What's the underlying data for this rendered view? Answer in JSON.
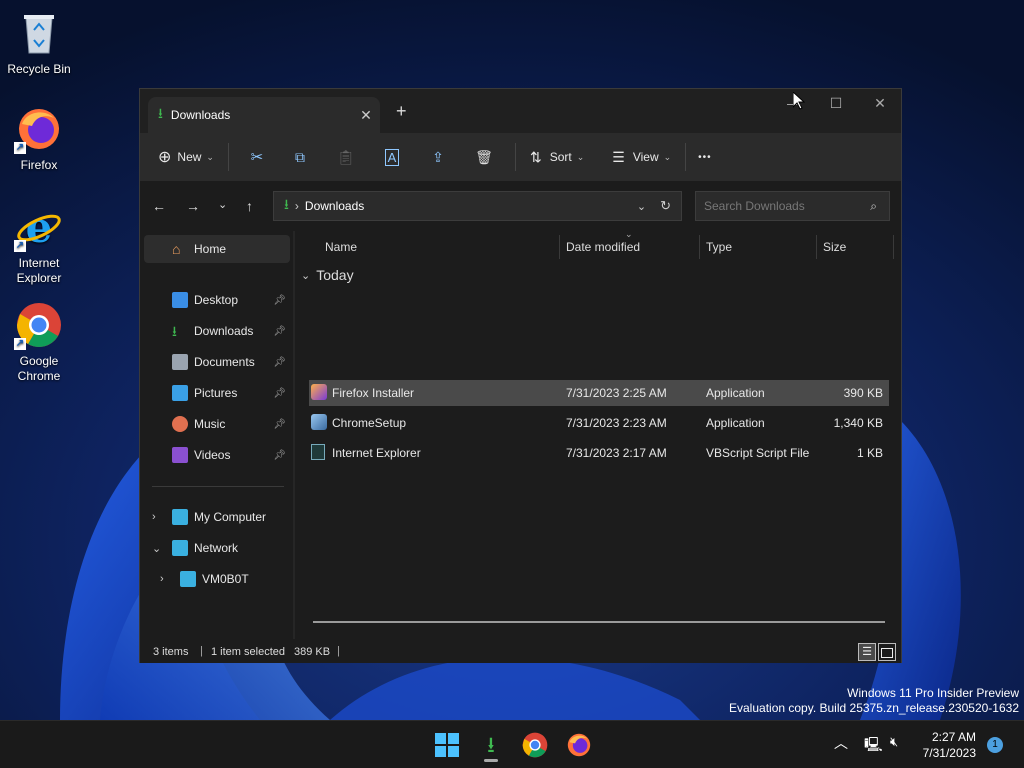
{
  "desktop": {
    "icons": [
      {
        "label": "Recycle Bin"
      },
      {
        "label": "Firefox"
      },
      {
        "label": "Internet Explorer"
      },
      {
        "label": "Google Chrome"
      }
    ],
    "watermark_line1": "Windows 11 Pro Insider Preview",
    "watermark_line2": "Evaluation copy. Build 25375.zn_release.230520-1632"
  },
  "explorer": {
    "tab_title": "Downloads",
    "toolbar": {
      "new_label": "New",
      "sort_label": "Sort",
      "view_label": "View",
      "more_label": "•••"
    },
    "address": {
      "current": "Downloads",
      "search_placeholder": "Search Downloads"
    },
    "nav": {
      "home": "Home",
      "quick_access": [
        {
          "label": "Desktop"
        },
        {
          "label": "Downloads"
        },
        {
          "label": "Documents"
        },
        {
          "label": "Pictures"
        },
        {
          "label": "Music"
        },
        {
          "label": "Videos"
        }
      ],
      "my_computer": "My Computer",
      "network": "Network",
      "network_child": "VM0B0T"
    },
    "columns": {
      "name": "Name",
      "date": "Date modified",
      "type": "Type",
      "size": "Size"
    },
    "group_label": "Today",
    "files": [
      {
        "name": "Firefox Installer",
        "date": "7/31/2023 2:25 AM",
        "type": "Application",
        "size": "390 KB",
        "selected": true
      },
      {
        "name": "ChromeSetup",
        "date": "7/31/2023 2:23 AM",
        "type": "Application",
        "size": "1,340 KB",
        "selected": false
      },
      {
        "name": "Internet Explorer",
        "date": "7/31/2023 2:17 AM",
        "type": "VBScript Script File",
        "size": "1 KB",
        "selected": false
      }
    ],
    "status": {
      "items": "3 items",
      "selected": "1 item selected",
      "size": "389 KB"
    }
  },
  "taskbar": {
    "time": "2:27 AM",
    "date": "7/31/2023",
    "notification_count": "1"
  },
  "colors": {
    "accent": "#4cc2ff",
    "downloads_green": "#3fb950",
    "selection": "#4a4a4a"
  }
}
